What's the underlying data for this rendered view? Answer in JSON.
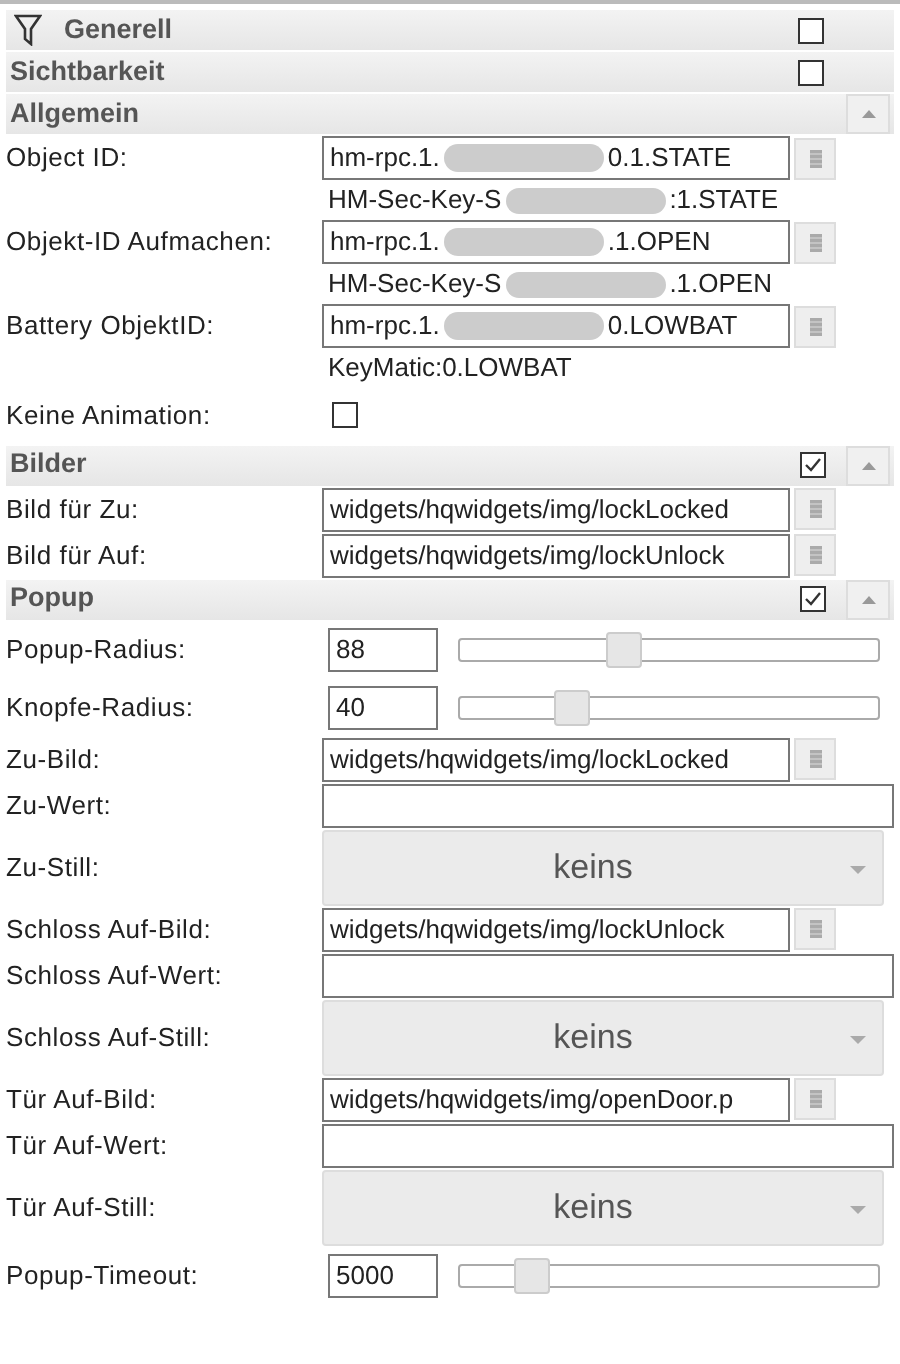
{
  "sections": [
    {
      "title": "Generell",
      "checkbox": false,
      "collapse_button": false
    },
    {
      "title": "Sichtbarkeit",
      "checkbox": false,
      "collapse_button": false
    },
    {
      "title": "Allgemein",
      "collapse_button": true,
      "rows": [
        {
          "kind": "id",
          "label": "Object ID:",
          "value_start": "hm-rpc.1.",
          "value_end": "0.1.STATE",
          "hint_start": "HM-Sec-Key-S",
          "hint_end": ":1.STATE"
        },
        {
          "kind": "id",
          "label": "Objekt-ID Aufmachen:",
          "value_start": "hm-rpc.1.",
          "value_end": ".1.OPEN",
          "hint_start": "HM-Sec-Key-S",
          "hint_end": ".1.OPEN"
        },
        {
          "kind": "id",
          "label": "Battery ObjektID:",
          "value_start": "hm-rpc.1.",
          "value_end": "0.LOWBAT",
          "hint_start": "KeyMatic:0.LOWBAT"
        },
        {
          "kind": "checkbox",
          "label": "Keine Animation:",
          "checked": false
        }
      ]
    },
    {
      "title": "Bilder",
      "checkbox": true,
      "collapse_button": true,
      "rows": [
        {
          "kind": "image",
          "label": "Bild für Zu:",
          "value": "widgets/hqwidgets/img/lockLocked"
        },
        {
          "kind": "image",
          "label": "Bild für Auf:",
          "value": "widgets/hqwidgets/img/lockUnlock"
        }
      ]
    },
    {
      "title": "Popup",
      "checkbox": true,
      "collapse_button": true,
      "rows": [
        {
          "kind": "slider",
          "label": "Popup-Radius:",
          "value": "88",
          "level": 0.39
        },
        {
          "kind": "slider",
          "label": "Knopfe-Radius:",
          "value": "40",
          "level": 0.27
        },
        {
          "kind": "image",
          "label": "Zu-Bild:",
          "value": "widgets/hqwidgets/img/lockLocked"
        },
        {
          "kind": "text",
          "label": "Zu-Wert:"
        },
        {
          "kind": "select",
          "label": "Zu-Still:",
          "value": "keins"
        },
        {
          "kind": "image",
          "label": "Schloss Auf-Bild:",
          "value": "widgets/hqwidgets/img/lockUnlock"
        },
        {
          "kind": "text",
          "label": "Schloss Auf-Wert:"
        },
        {
          "kind": "select",
          "label": "Schloss Auf-Still:",
          "value": "keins"
        },
        {
          "kind": "image",
          "label": "Tür Auf-Bild:",
          "value": "widgets/hqwidgets/img/openDoor.p"
        },
        {
          "kind": "text",
          "label": "Tür Auf-Wert:"
        },
        {
          "kind": "select",
          "label": "Tür Auf-Still:",
          "value": "keins"
        },
        {
          "kind": "slider",
          "label": "Popup-Timeout:",
          "value": "5000",
          "level": 0.17
        }
      ]
    }
  ]
}
